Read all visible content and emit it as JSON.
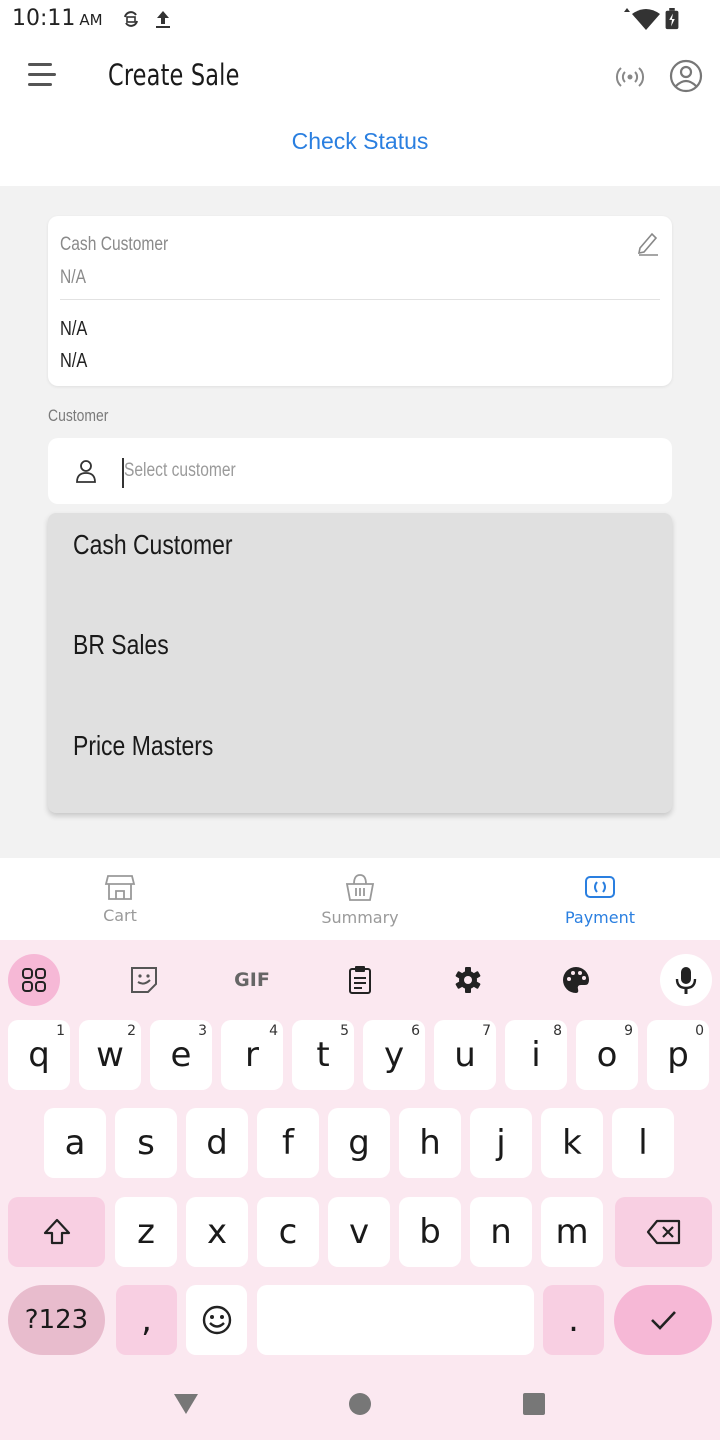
{
  "status_bar": {
    "time": "10:11",
    "ampm": "AM"
  },
  "app_bar": {
    "title": "Create Sale"
  },
  "check_status_label": "Check Status",
  "customer_card": {
    "name": "Cash Customer",
    "line1": "N/A",
    "line2": "N/A",
    "line3": "N/A"
  },
  "customer_field": {
    "label": "Customer",
    "placeholder": "Select customer"
  },
  "dropdown": {
    "options": [
      "Cash Customer",
      "BR Sales",
      "Price Masters"
    ]
  },
  "bottom_nav": {
    "items": [
      {
        "label": "Cart",
        "icon": "store-icon"
      },
      {
        "label": "Summary",
        "icon": "basket-icon"
      },
      {
        "label": "Payment",
        "icon": "payment-icon"
      }
    ],
    "active": "Payment"
  },
  "keyboard": {
    "toolbar": [
      "apps-icon",
      "sticker-icon",
      "GIF",
      "clipboard-icon",
      "settings-icon",
      "palette-icon",
      "mic-icon"
    ],
    "row1": [
      {
        "k": "q",
        "s": "1"
      },
      {
        "k": "w",
        "s": "2"
      },
      {
        "k": "e",
        "s": "3"
      },
      {
        "k": "r",
        "s": "4"
      },
      {
        "k": "t",
        "s": "5"
      },
      {
        "k": "y",
        "s": "6"
      },
      {
        "k": "u",
        "s": "7"
      },
      {
        "k": "i",
        "s": "8"
      },
      {
        "k": "o",
        "s": "9"
      },
      {
        "k": "p",
        "s": "0"
      }
    ],
    "row2": [
      "a",
      "s",
      "d",
      "f",
      "g",
      "h",
      "j",
      "k",
      "l"
    ],
    "row3": [
      "z",
      "x",
      "c",
      "v",
      "b",
      "n",
      "m"
    ],
    "symbols_label": "?123",
    "comma": ",",
    "period": "."
  },
  "colors": {
    "accent": "#2a7fe0",
    "keyboard_bg": "#fbe8f0",
    "keyboard_accent": "#f6b8d6"
  }
}
